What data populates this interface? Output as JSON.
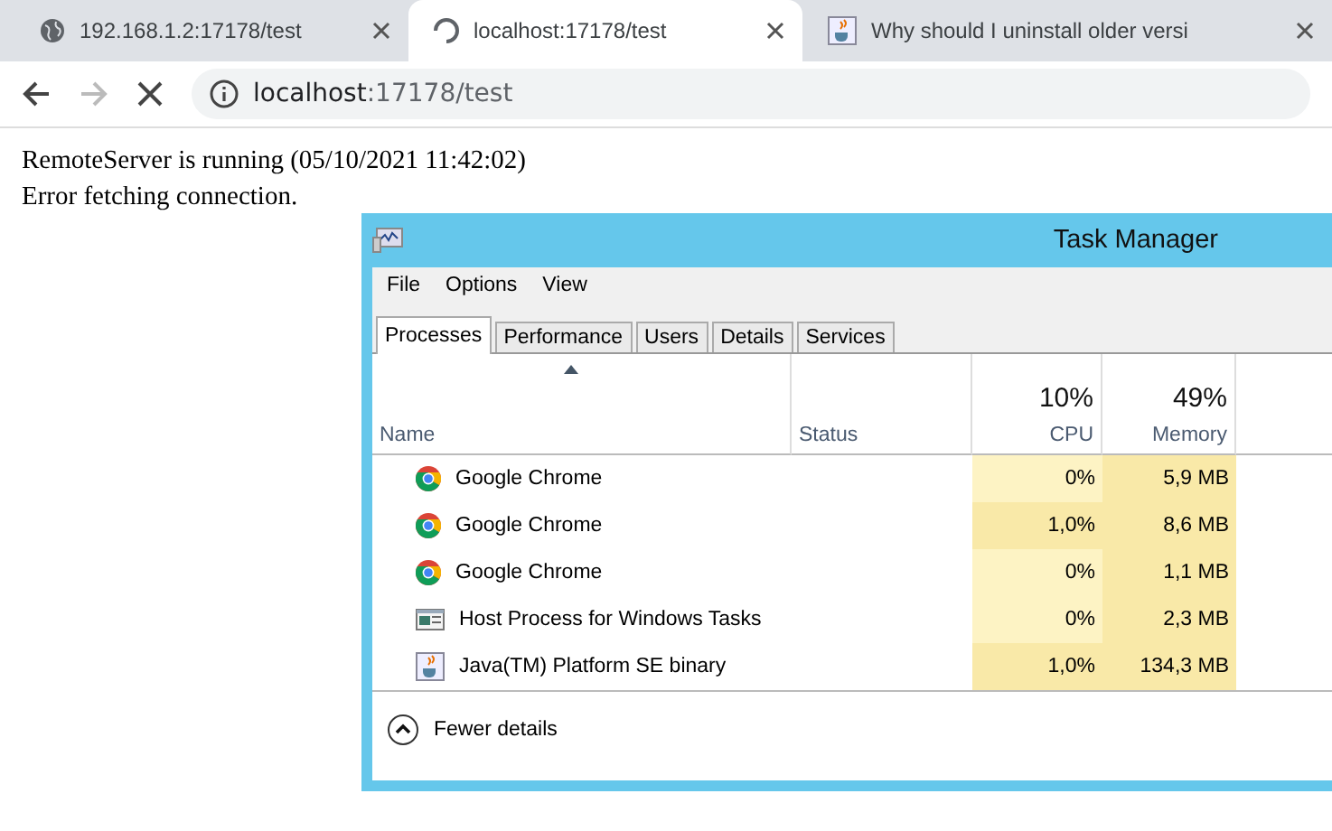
{
  "browser": {
    "tabs": [
      {
        "title": "192.168.1.2:17178/test",
        "selected": false
      },
      {
        "title": "localhost:17178/test",
        "selected": true
      },
      {
        "title": "Why should I uninstall older versi",
        "selected": false
      }
    ],
    "address": {
      "host": "localhost",
      "path": ":17178/test"
    }
  },
  "page": {
    "lines": [
      "RemoteServer is running (05/10/2021 11:42:02)",
      "Error fetching connection."
    ]
  },
  "task_manager": {
    "title": "Task Manager",
    "menu": [
      "File",
      "Options",
      "View"
    ],
    "tabs": [
      {
        "label": "Processes",
        "selected": true
      },
      {
        "label": "Performance",
        "selected": false
      },
      {
        "label": "Users",
        "selected": false
      },
      {
        "label": "Details",
        "selected": false
      },
      {
        "label": "Services",
        "selected": false
      }
    ],
    "columns": {
      "name": "Name",
      "status": "Status",
      "cpu_total": "10%",
      "cpu": "CPU",
      "memory_total": "49%",
      "memory": "Memory"
    },
    "rows": [
      {
        "kind": "chrome",
        "name": "Google Chrome",
        "cpu": "0%",
        "memory": "5,9 MB"
      },
      {
        "kind": "chrome",
        "name": "Google Chrome",
        "cpu": "1,0%",
        "memory": "8,6 MB"
      },
      {
        "kind": "chrome",
        "name": "Google Chrome",
        "cpu": "0%",
        "memory": "1,1 MB"
      },
      {
        "kind": "host",
        "name": "Host Process for Windows Tasks",
        "cpu": "0%",
        "memory": "2,3 MB"
      },
      {
        "kind": "java",
        "name": "Java(TM) Platform SE binary",
        "cpu": "1,0%",
        "memory": "134,3 MB"
      }
    ],
    "footer": "Fewer details"
  }
}
